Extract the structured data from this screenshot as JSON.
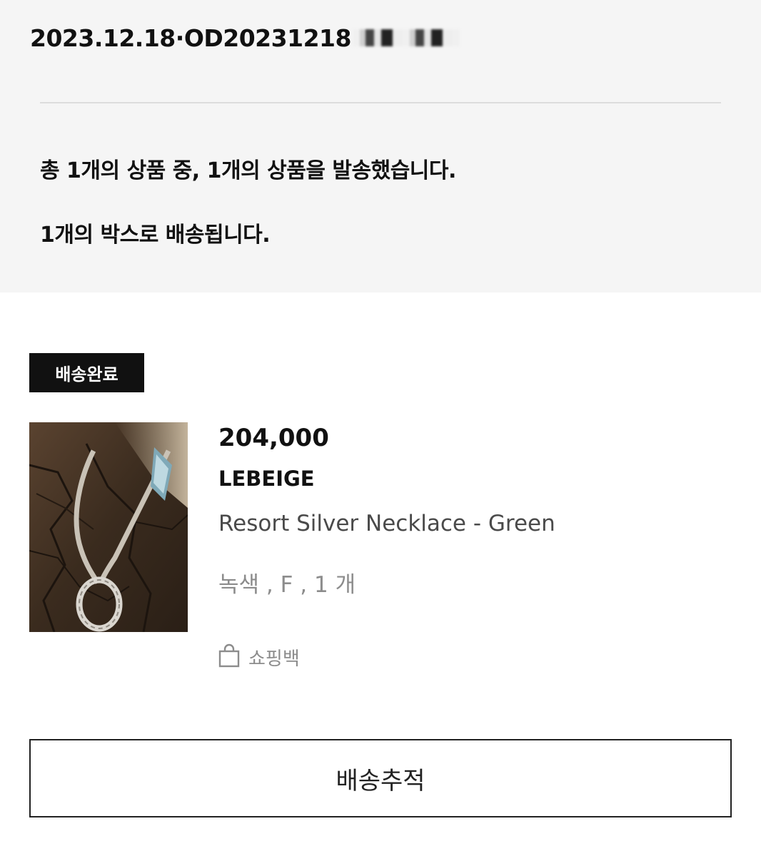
{
  "order": {
    "date": "2023.12.18",
    "separator": "·",
    "order_number_visible": "OD20231218"
  },
  "shipment": {
    "summary_line": "총 1개의 상품 중, 1개의 상품을 발송했습니다.",
    "box_line": "1개의 박스로 배송됩니다."
  },
  "item": {
    "status_badge": "배송완료",
    "price": "204,000",
    "brand": "LEBEIGE",
    "name": "Resort Silver Necklace - Green",
    "option": "녹색 , F , 1 개",
    "packaging": "쇼핑백",
    "packaging_icon": "shopping-bag-icon"
  },
  "actions": {
    "track_label": "배송추적"
  },
  "colors": {
    "summary_background": "#f5f5f5",
    "badge_background": "#111111",
    "muted_text": "#8c8c8c"
  }
}
